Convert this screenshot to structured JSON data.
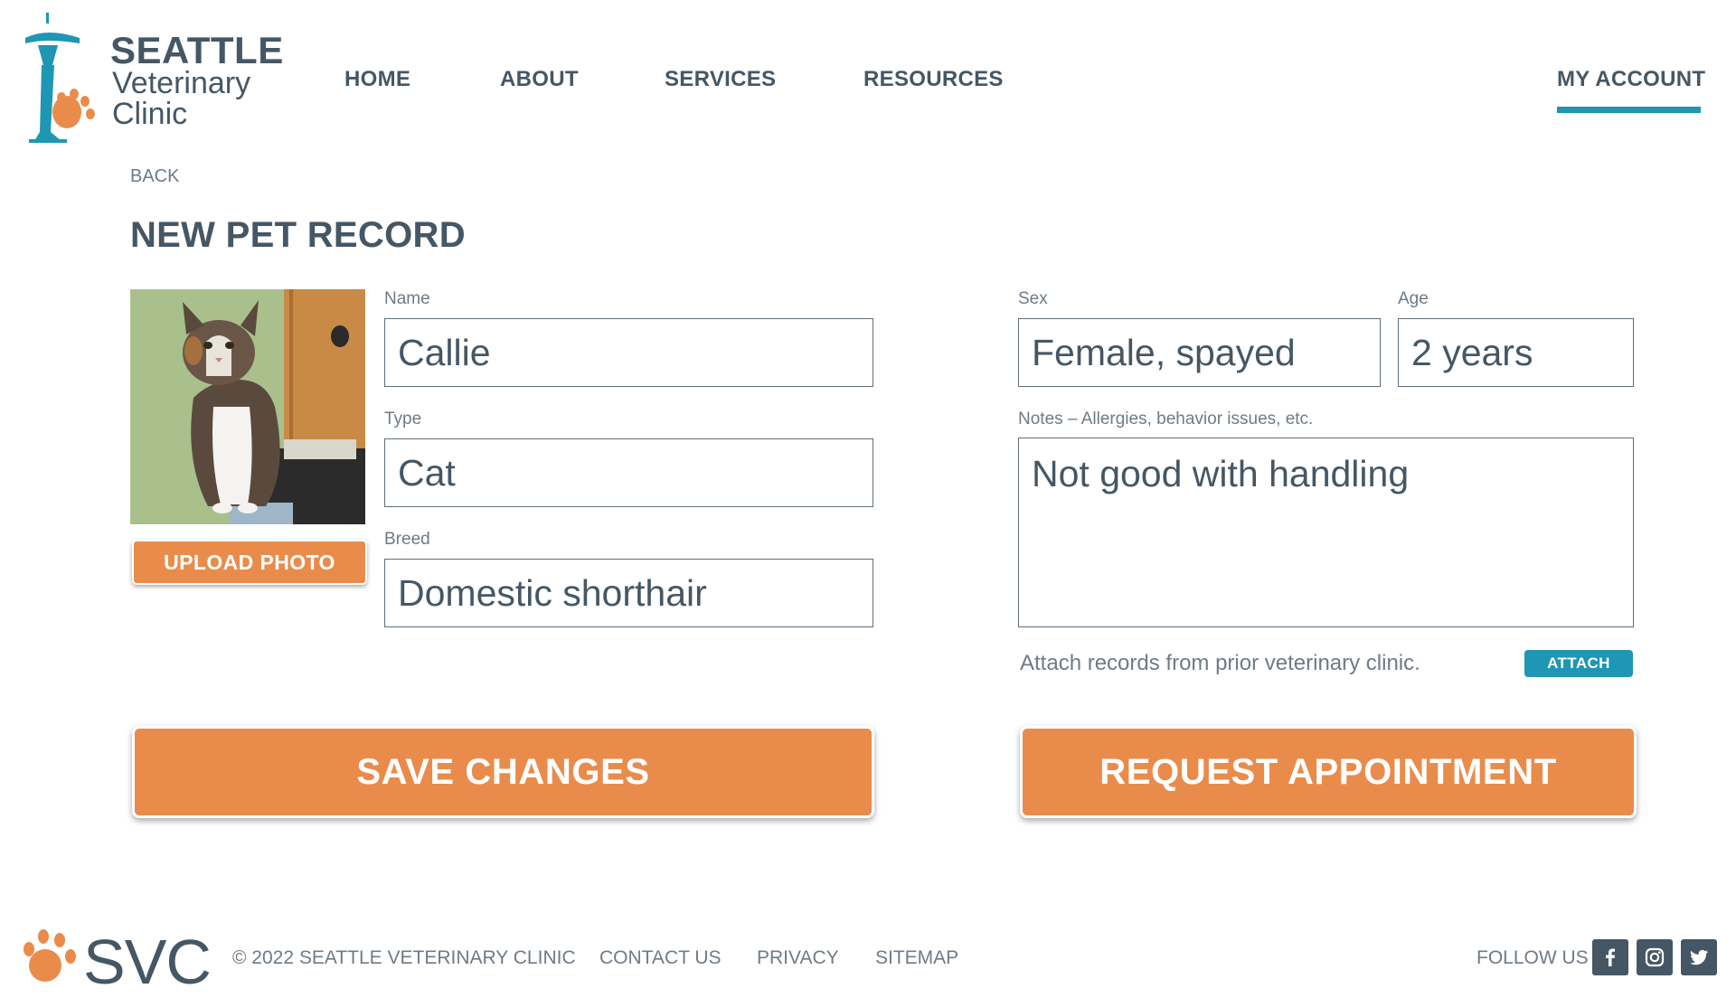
{
  "brand": {
    "name_line1": "SEATTLE",
    "name_line2": "Veterinary",
    "name_line3": "Clinic",
    "abbr": "SVC",
    "colors": {
      "primary": "#1e96b4",
      "accent": "#e98c4b",
      "text": "#455765"
    }
  },
  "nav": {
    "items": [
      {
        "label": "HOME"
      },
      {
        "label": "ABOUT"
      },
      {
        "label": "SERVICES"
      },
      {
        "label": "RESOURCES"
      }
    ],
    "account": {
      "label": "MY ACCOUNT",
      "active": true
    }
  },
  "page": {
    "back": "BACK",
    "title": "NEW PET RECORD"
  },
  "photo": {
    "upload_label": "UPLOAD PHOTO"
  },
  "form": {
    "name": {
      "label": "Name",
      "value": "Callie"
    },
    "type": {
      "label": "Type",
      "value": "Cat"
    },
    "breed": {
      "label": "Breed",
      "value": "Domestic shorthair"
    },
    "sex": {
      "label": "Sex",
      "value": "Female, spayed"
    },
    "age": {
      "label": "Age",
      "value": "2 years"
    },
    "notes": {
      "label": "Notes – Allergies, behavior issues, etc.",
      "value": "Not good with handling"
    },
    "attach_text": "Attach records from prior veterinary clinic.",
    "attach_label": "ATTACH"
  },
  "actions": {
    "save": "SAVE CHANGES",
    "request": "REQUEST APPOINTMENT"
  },
  "footer": {
    "copyright": "© 2022  SEATTLE VETERINARY CLINIC",
    "links": [
      "CONTACT US",
      "PRIVACY",
      "SITEMAP"
    ],
    "follow": "FOLLOW US",
    "social_icons": [
      "facebook-icon",
      "instagram-icon",
      "twitter-icon"
    ]
  }
}
